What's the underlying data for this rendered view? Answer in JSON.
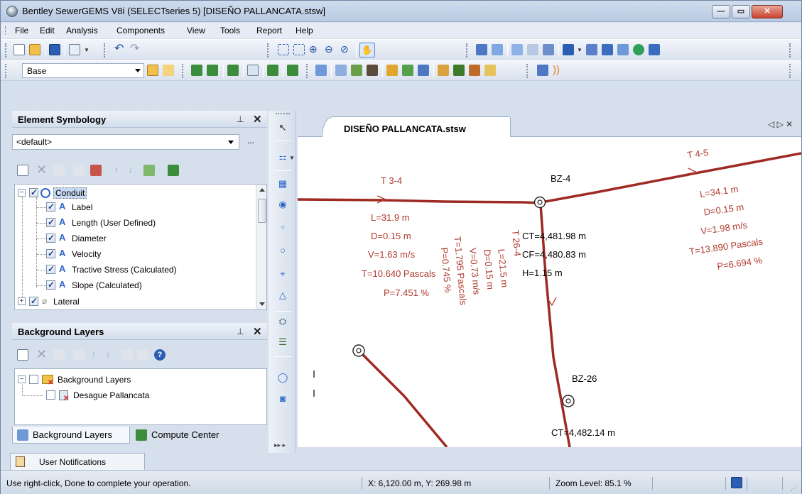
{
  "window": {
    "title": "Bentley SewerGEMS V8i (SELECTseries 5) [DISEÑO PALLANCATA.stsw]",
    "min_glyph": "—",
    "max_glyph": "▭",
    "close_glyph": "✕"
  },
  "menu": {
    "items": [
      {
        "label": "File",
        "accel": "F"
      },
      {
        "label": "Edit",
        "accel": "E"
      },
      {
        "label": "Analysis",
        "accel": "A"
      },
      {
        "label": "Components",
        "accel": "C"
      },
      {
        "label": "View",
        "accel": "V"
      },
      {
        "label": "Tools",
        "accel": "T"
      },
      {
        "label": "Report",
        "accel": "R"
      },
      {
        "label": "Help",
        "accel": "H"
      }
    ]
  },
  "toolbar2": {
    "scenario_combo": "Base"
  },
  "element_symbology": {
    "title": "Element Symbology",
    "pin": "⊥",
    "close": "✕",
    "profile_combo": "<default>",
    "more": "...",
    "tree": [
      {
        "label": "Conduit",
        "level": 0,
        "expanded": true,
        "checked": true
      },
      {
        "label": "Label",
        "level": 1,
        "checked": true
      },
      {
        "label": "Length (User Defined)",
        "level": 1,
        "checked": true
      },
      {
        "label": "Diameter",
        "level": 1,
        "checked": true
      },
      {
        "label": "Velocity",
        "level": 1,
        "checked": true
      },
      {
        "label": "Tractive Stress (Calculated)",
        "level": 1,
        "checked": true
      },
      {
        "label": "Slope (Calculated)",
        "level": 1,
        "checked": true
      },
      {
        "label": "Lateral",
        "level": 0,
        "expanded": false,
        "checked": true
      }
    ]
  },
  "background_layers": {
    "title": "Background Layers",
    "pin": "⊥",
    "close": "✕",
    "tree": [
      {
        "label": "Background Layers"
      },
      {
        "label": "Desague Pallancata"
      }
    ]
  },
  "bottom_tabs": {
    "background_layers": "Background Layers",
    "compute_center": "Compute Center"
  },
  "document": {
    "tab_title": "DISEÑO PALLANCATA.stsw",
    "nav": "◁ ▷ ✕"
  },
  "drawing": {
    "conduit_t34": {
      "name": "T 3-4",
      "lines": [
        "L=31.9 m",
        "D=0.15 m",
        "V=1.63 m/s",
        "T=10.640 Pascals",
        "P=7.451 %"
      ]
    },
    "conduit_t45": {
      "name": "T 4-5",
      "lines": [
        "L=34.1 m",
        "D=0.15 m",
        "V=1.98 m/s",
        "T=13.890 Pascals",
        "P=6.694 %"
      ]
    },
    "conduit_t264": {
      "name": "T 26-4",
      "lines": [
        "L=21.5 m",
        "D=0.15 m",
        "V=0.73 m/s",
        "T=1.795 Pascals",
        "P=0.745 %"
      ]
    },
    "node_bz4": {
      "name": "BZ-4",
      "lines": [
        "CT=4,481.98 m",
        "CF=4,480.83 m",
        "H=1.15 m"
      ]
    },
    "node_bz26": {
      "name": "BZ-26",
      "lines": [
        "CT=4,482.14 m"
      ]
    },
    "conduit_color": "#9e2a24",
    "label_color": "#b03a2e"
  },
  "notifications": {
    "tab": "User Notifications"
  },
  "status": {
    "message": "Use right-click, Done to complete your operation.",
    "coords": "X: 6,120.00 m, Y: 269.98 m",
    "zoom": "Zoom Level: 85.1 %"
  }
}
